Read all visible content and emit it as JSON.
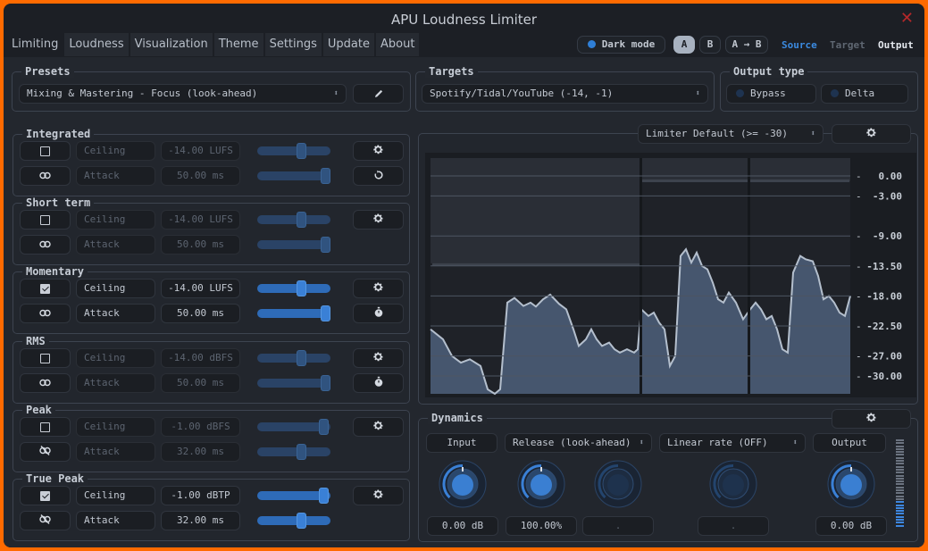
{
  "window": {
    "title": "APU Loudness Limiter",
    "close_icon": "close-icon"
  },
  "tabs": [
    {
      "label": "Limiting",
      "active": true
    },
    {
      "label": "Loudness",
      "active": false
    },
    {
      "label": "Visualization",
      "active": false
    },
    {
      "label": "Theme",
      "active": false
    },
    {
      "label": "Settings",
      "active": false
    },
    {
      "label": "Update",
      "active": false
    },
    {
      "label": "About",
      "active": false
    }
  ],
  "topbar": {
    "dark_mode": "Dark mode",
    "dark_mode_on": true,
    "a": "A",
    "b": "B",
    "a_to_b": "A → B",
    "view_source": "Source",
    "view_target": "Target",
    "view_output": "Output",
    "accent_color": "#3b8ae0"
  },
  "presets": {
    "legend": "Presets",
    "value": "Mixing & Mastering - Focus (look-ahead)",
    "edit_icon": "pencil-icon"
  },
  "targets": {
    "legend": "Targets",
    "value": "Spotify/Tidal/YouTube (-14, -1)"
  },
  "output_type": {
    "legend": "Output type",
    "bypass": "Bypass",
    "delta": "Delta",
    "bypass_on": false,
    "delta_on": false
  },
  "sections": [
    {
      "legend": "Integrated",
      "enabled": false,
      "ceiling_label": "Ceiling",
      "ceiling_value": "-14.00 LUFS",
      "ceiling_slider": 0.62,
      "attack_label": "Attack",
      "attack_value": "50.00 ms",
      "attack_slider": 1.0,
      "linked": true,
      "row2_icon": "reset-icon"
    },
    {
      "legend": "Short term",
      "enabled": false,
      "ceiling_label": "Ceiling",
      "ceiling_value": "-14.00 LUFS",
      "ceiling_slider": 0.62,
      "attack_label": "Attack",
      "attack_value": "50.00 ms",
      "attack_slider": 1.0,
      "linked": true,
      "row2_icon": ""
    },
    {
      "legend": "Momentary",
      "enabled": true,
      "ceiling_label": "Ceiling",
      "ceiling_value": "-14.00 LUFS",
      "ceiling_slider": 0.62,
      "attack_label": "Attack",
      "attack_value": "50.00 ms",
      "attack_slider": 1.0,
      "linked": true,
      "row2_icon": "stopwatch-icon"
    },
    {
      "legend": "RMS",
      "enabled": false,
      "ceiling_label": "Ceiling",
      "ceiling_value": "-14.00 dBFS",
      "ceiling_slider": 0.62,
      "attack_label": "Attack",
      "attack_value": "50.00 ms",
      "attack_slider": 1.0,
      "linked": true,
      "row2_icon": "stopwatch-icon"
    },
    {
      "legend": "Peak",
      "enabled": false,
      "ceiling_label": "Ceiling",
      "ceiling_value": "-1.00 dBFS",
      "ceiling_slider": 0.97,
      "attack_label": "Attack",
      "attack_value": "32.00 ms",
      "attack_slider": 0.62,
      "linked": false,
      "row2_icon": ""
    },
    {
      "legend": "True Peak",
      "enabled": true,
      "ceiling_label": "Ceiling",
      "ceiling_value": "-1.00 dBTP",
      "ceiling_slider": 0.97,
      "attack_label": "Attack",
      "attack_value": "32.00 ms",
      "attack_slider": 0.62,
      "linked": false,
      "row2_icon": ""
    }
  ],
  "meter": {
    "mode_select": "Limiter Default (>= -30)",
    "scale_labels": [
      "0.00",
      "-3.00",
      "-9.00",
      "-13.50",
      "-18.00",
      "-22.50",
      "-27.00",
      "-30.00"
    ],
    "scale_values": [
      0,
      -3,
      -9,
      -13.5,
      -18,
      -22.5,
      -27,
      -30
    ]
  },
  "dynamics": {
    "legend": "Dynamics",
    "input_label": "Input",
    "release_select": "Release (look-ahead)",
    "linear_select": "Linear rate (OFF)",
    "output_label": "Output",
    "knobs": [
      {
        "name": "input",
        "value": "0.00 dB",
        "active": true
      },
      {
        "name": "release",
        "value": "100.00%",
        "active": true
      },
      {
        "name": "release-aux",
        "value": ".",
        "active": false
      },
      {
        "name": "linear-rate",
        "value": ".",
        "active": false
      },
      {
        "name": "output",
        "value": "0.00 dB",
        "active": true
      }
    ],
    "level_meter_fraction": 0.3
  }
}
